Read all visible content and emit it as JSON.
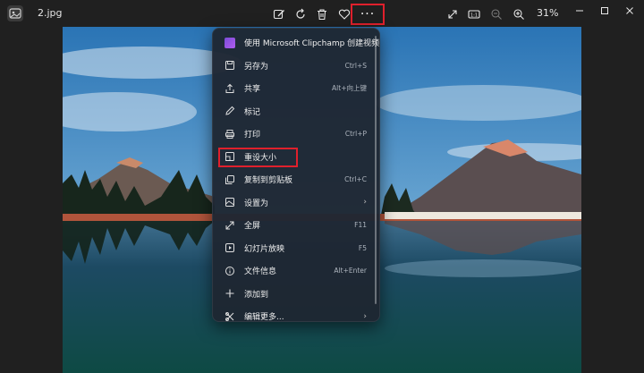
{
  "titlebar": {
    "file_name": "2.jpg",
    "zoom": "31%",
    "more_label": "···"
  },
  "menu": {
    "items": [
      {
        "label": "使用 Microsoft Clipchamp 创建视频",
        "shortcut": ""
      },
      {
        "label": "另存为",
        "shortcut": "Ctrl+S"
      },
      {
        "label": "共享",
        "shortcut": "Alt+向上键"
      },
      {
        "label": "标记",
        "shortcut": ""
      },
      {
        "label": "打印",
        "shortcut": "Ctrl+P"
      },
      {
        "label": "重设大小",
        "shortcut": ""
      },
      {
        "label": "复制到剪贴板",
        "shortcut": "Ctrl+C"
      },
      {
        "label": "设置为",
        "shortcut": ""
      },
      {
        "label": "全屏",
        "shortcut": "F11"
      },
      {
        "label": "幻灯片放映",
        "shortcut": "F5"
      },
      {
        "label": "文件信息",
        "shortcut": "Alt+Enter"
      },
      {
        "label": "添加到",
        "shortcut": ""
      },
      {
        "label": "编辑更多...",
        "shortcut": ""
      }
    ],
    "submenu_chevron": "›"
  },
  "colors": {
    "background": "#202020",
    "highlight": "#e0202c",
    "menu_bg": "#1e2632"
  }
}
